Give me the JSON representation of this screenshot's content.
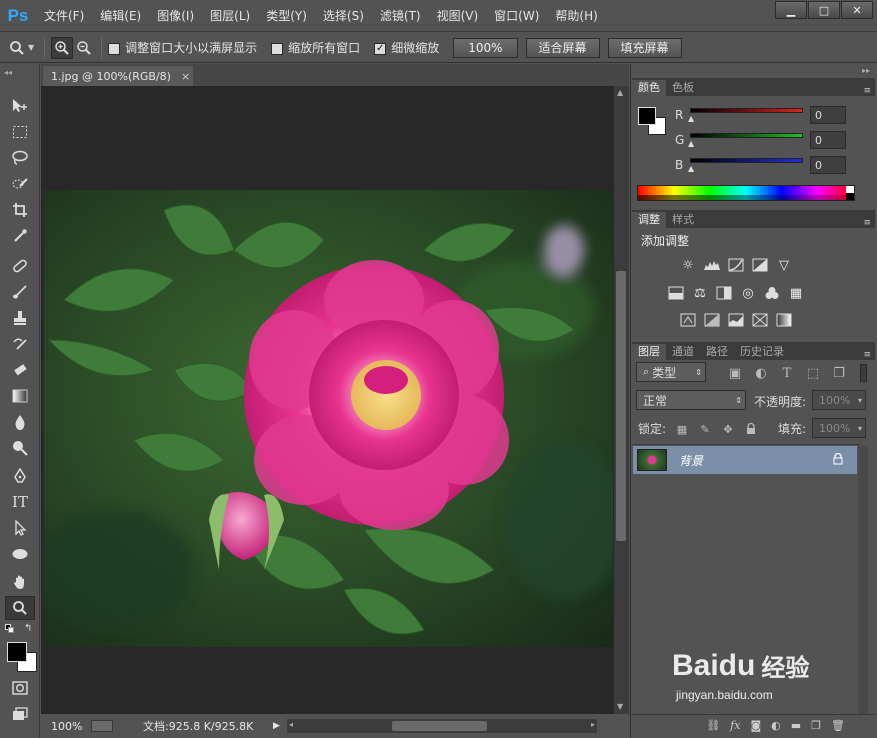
{
  "app": {
    "logo": "Ps"
  },
  "menu": [
    "文件(F)",
    "编辑(E)",
    "图像(I)",
    "图层(L)",
    "类型(Y)",
    "选择(S)",
    "滤镜(T)",
    "视图(V)",
    "窗口(W)",
    "帮助(H)"
  ],
  "window_buttons": {
    "minimize": "▁",
    "maximize": "□",
    "close": "✕"
  },
  "options": {
    "resize_windows": "调整窗口大小以满屏显示",
    "zoom_all": "缩放所有窗口",
    "scrubby": "细微缩放",
    "scrubby_checked": true,
    "btn_100": "100%",
    "btn_fit": "适合屏幕",
    "btn_fill": "填充屏幕"
  },
  "document": {
    "tab_title": "1.jpg @ 100%(RGB/8)",
    "tab_close": "×",
    "zoom": "100%",
    "doc_info": "文档:925.8 K/925.8K"
  },
  "color_panel": {
    "tabs": [
      "颜色",
      "色板"
    ],
    "channels": [
      {
        "label": "R",
        "value": "0",
        "color": "#e02020"
      },
      {
        "label": "G",
        "value": "0",
        "color": "#20c020"
      },
      {
        "label": "B",
        "value": "0",
        "color": "#2030e0"
      }
    ]
  },
  "adjust_panel": {
    "tabs": [
      "调整",
      "样式"
    ],
    "title": "添加调整"
  },
  "layers_panel": {
    "tabs": [
      "图层",
      "通道",
      "路径",
      "历史记录"
    ],
    "filter_kind": "类型",
    "blend_mode": "正常",
    "opacity_label": "不透明度:",
    "opacity_value": "100%",
    "lock_label": "锁定:",
    "fill_label": "填充:",
    "fill_value": "100%",
    "layers": [
      {
        "name": "背景"
      }
    ]
  },
  "watermark": {
    "brand": "Baidu",
    "sub": "经验",
    "url": "jingyan.baidu.com"
  },
  "colors": {
    "accent": "#31a8ff",
    "ui_bg": "#535353",
    "canvas_bg": "#282828",
    "layer_selected": "#7b8fa8"
  }
}
